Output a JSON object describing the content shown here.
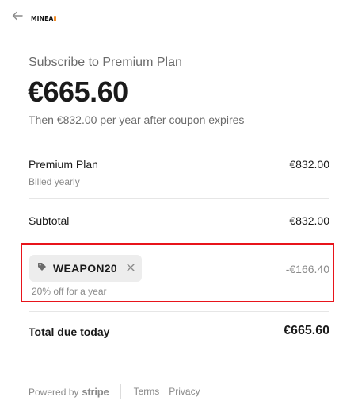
{
  "header": {
    "back_icon": "arrow-left-icon",
    "logo_text": "MINEA",
    "logo_accent_color": "#f28c28"
  },
  "summary": {
    "title": "Subscribe to Premium Plan",
    "price": "€665.60",
    "price_note": "Then €832.00 per year after coupon expires"
  },
  "line_items": {
    "plan_name": "Premium Plan",
    "plan_billing": "Billed yearly",
    "plan_amount": "€832.00",
    "subtotal_label": "Subtotal",
    "subtotal_amount": "€832.00"
  },
  "coupon": {
    "icon": "tag-icon",
    "code": "WEAPON20",
    "remove_icon": "close-icon",
    "description": "20% off for a year",
    "discount_amount": "-€166.40",
    "highlight_color": "#e8141b"
  },
  "total": {
    "label": "Total due today",
    "amount": "€665.60"
  },
  "footer": {
    "powered_by": "Powered by",
    "stripe": "stripe",
    "terms": "Terms",
    "privacy": "Privacy"
  }
}
